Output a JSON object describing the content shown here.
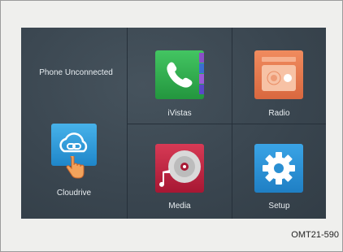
{
  "screen": {
    "phone_status": "Phone Unconnected",
    "apps": [
      {
        "id": "cloudrive",
        "label": "Cloudrive",
        "icon": "cloud-link-icon"
      },
      {
        "id": "ivistas",
        "label": "iVistas",
        "icon": "phone-handset-icon"
      },
      {
        "id": "radio",
        "label": "Radio",
        "icon": "radio-icon"
      },
      {
        "id": "media",
        "label": "Media",
        "icon": "music-disc-icon"
      },
      {
        "id": "setup",
        "label": "Setup",
        "icon": "gear-icon"
      }
    ]
  },
  "figure_code": "OMT21-590",
  "colors": {
    "screen_bg": "#3a4650",
    "ivistas_green": "#2ea64a",
    "radio_orange": "#e6794e",
    "media_red": "#c7213f",
    "setup_blue": "#2a8fd2",
    "cloud_blue": "#2f9bd9"
  }
}
